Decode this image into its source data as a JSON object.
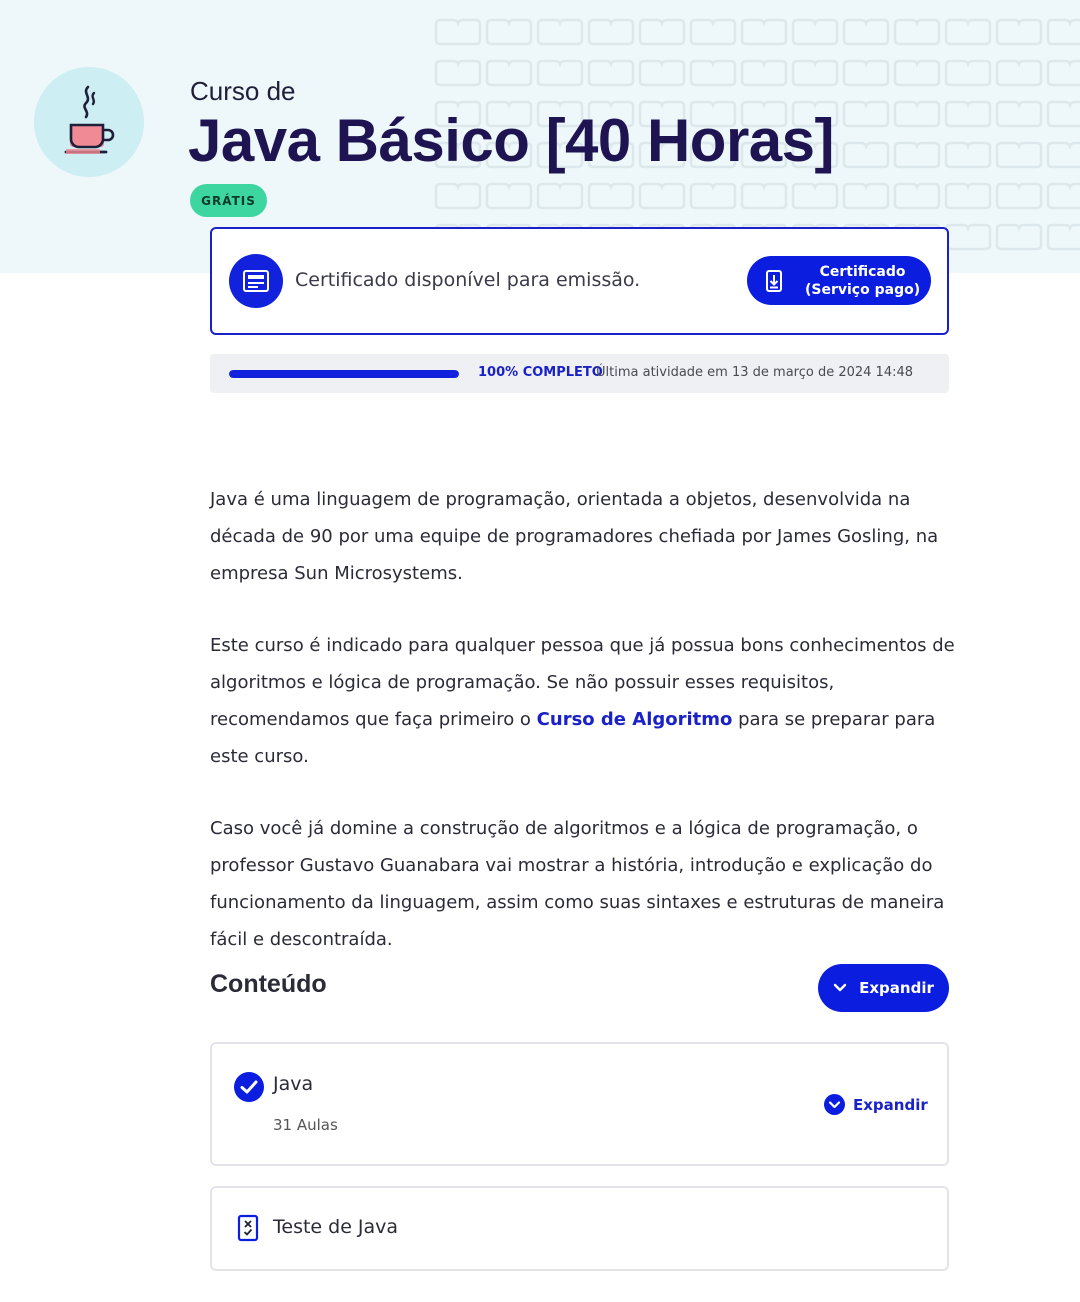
{
  "course": {
    "subtitle": "Curso de",
    "title": "Java Básico [40 Horas]",
    "badge": "GRÁTIS"
  },
  "certificate": {
    "message": "Certificado disponível para emissão.",
    "button_label": "Certificado\n(Serviço pago)"
  },
  "progress": {
    "percent": 100,
    "percent_label": "100% COMPLETO",
    "last_activity": "Última atividade em 13 de março de 2024 14:48"
  },
  "description": {
    "p1": "Java é uma linguagem de programação, orientada a objetos, desenvolvida na década de 90 por uma equipe de programadores chefiada por James Gosling, na empresa Sun Microsystems.",
    "p2_before": "Este curso é indicado para qualquer pessoa que já possua bons conhecimentos de algoritmos e lógica de programação. Se não possuir esses requisitos, recomendamos que faça primeiro o ",
    "p2_link": "Curso de Algoritmo",
    "p2_after": " para se preparar para este curso.",
    "p3": "Caso você já domine a construção de algoritmos e a lógica de programação, o professor Gustavo Guanabara vai mostrar a história, introdução e explicação do funcionamento da linguagem, assim como suas sintaxes e estruturas de maneira fácil e descontraída."
  },
  "content": {
    "heading": "Conteúdo",
    "expand_all_label": "Expandir",
    "modules": [
      {
        "name": "Java",
        "lessons": "31 Aulas",
        "expand_label": "Expandir",
        "completed": true
      }
    ],
    "test": {
      "name": "Teste de Java"
    }
  },
  "colors": {
    "primary": "#0b1ee0",
    "title": "#1e1452",
    "badge": "#3dd5a0",
    "hero_bg": "#eef7f9"
  },
  "icons": {
    "logo": "coffee-cup-icon",
    "certificate": "certificate-icon",
    "document": "document-download-icon",
    "chevron": "chevron-down-icon",
    "check": "check-circle-icon",
    "test": "quiz-icon"
  }
}
